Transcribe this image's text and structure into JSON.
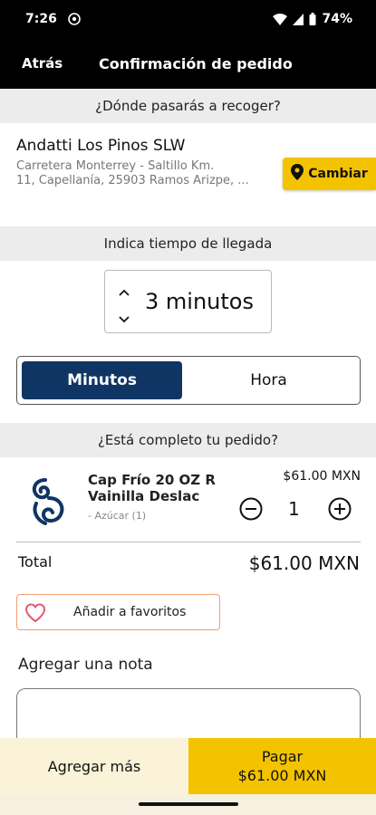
{
  "status_bar": {
    "time": "7:26",
    "battery": "74%",
    "icons": [
      "whatsapp-icon",
      "wifi-icon",
      "signal-icon",
      "battery-icon"
    ]
  },
  "header": {
    "back_label": "Atrás",
    "title": "Confirmación de pedido"
  },
  "pickup": {
    "section_title": "¿Dónde pasarás a recoger?",
    "store_name": "Andatti Los Pinos SLW",
    "address_line1": "Carretera Monterrey - Saltillo Km.",
    "address_line2": "11, Capellanía, 25903 Ramos Arizpe, ...",
    "change_label": "Cambiar"
  },
  "arrival": {
    "section_title": "Indica tiempo de llegada",
    "value": "3 minutos",
    "options": [
      "Minutos",
      "Hora"
    ],
    "selected": "Minutos"
  },
  "order": {
    "section_title": "¿Está completo tu pedido?",
    "items": [
      {
        "name": "Cap Frío 20 OZ R Vainilla Deslac",
        "modifier": "- Azúcar (1)",
        "price": "$61.00 MXN",
        "quantity": "1"
      }
    ],
    "total_label": "Total",
    "total_value": "$61.00 MXN",
    "favorite_label": "Añadir a favoritos",
    "note_label": "Agregar una nota"
  },
  "footer": {
    "add_more_label": "Agregar más",
    "pay_label": "Pagar",
    "pay_amount": "$61.00 MXN"
  },
  "colors": {
    "accent": "#f4c300",
    "primary": "#0f3564",
    "header_bg": "#000000",
    "section_bg": "#ececec"
  }
}
